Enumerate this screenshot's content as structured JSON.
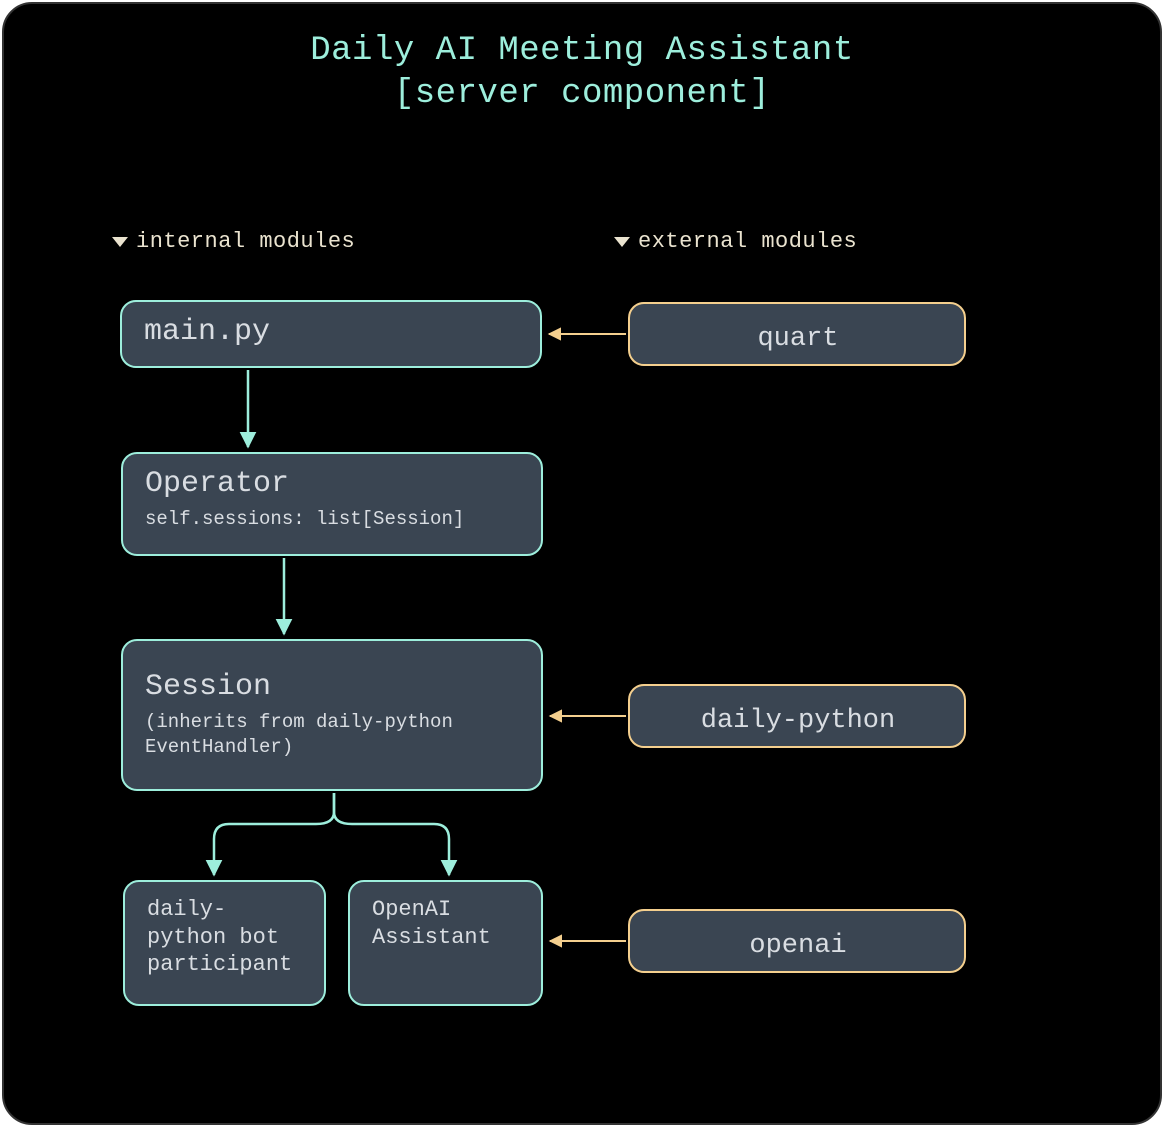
{
  "title": "Daily AI Meeting Assistant\n[server component]",
  "columns": {
    "internal": "internal modules",
    "external": "external modules"
  },
  "nodes": {
    "main": {
      "title": "main.py"
    },
    "operator": {
      "title": "Operator",
      "subtitle": "self.sessions: list[Session]"
    },
    "session": {
      "title": "Session",
      "subtitle": "(inherits from daily-python EventHandler)"
    },
    "bot": {
      "text": "daily-python bot participant"
    },
    "assistant": {
      "text": "OpenAI Assistant"
    },
    "quart": {
      "label": "quart"
    },
    "daily_python": {
      "label": "daily-python"
    },
    "openai": {
      "label": "openai"
    }
  },
  "colors": {
    "bg": "#000000",
    "nodeFill": "#3a4552",
    "internalStroke": "#9deedc",
    "externalStroke": "#f4cf8e",
    "titleColor": "#9deedc",
    "headerColor": "#eae3cf"
  }
}
